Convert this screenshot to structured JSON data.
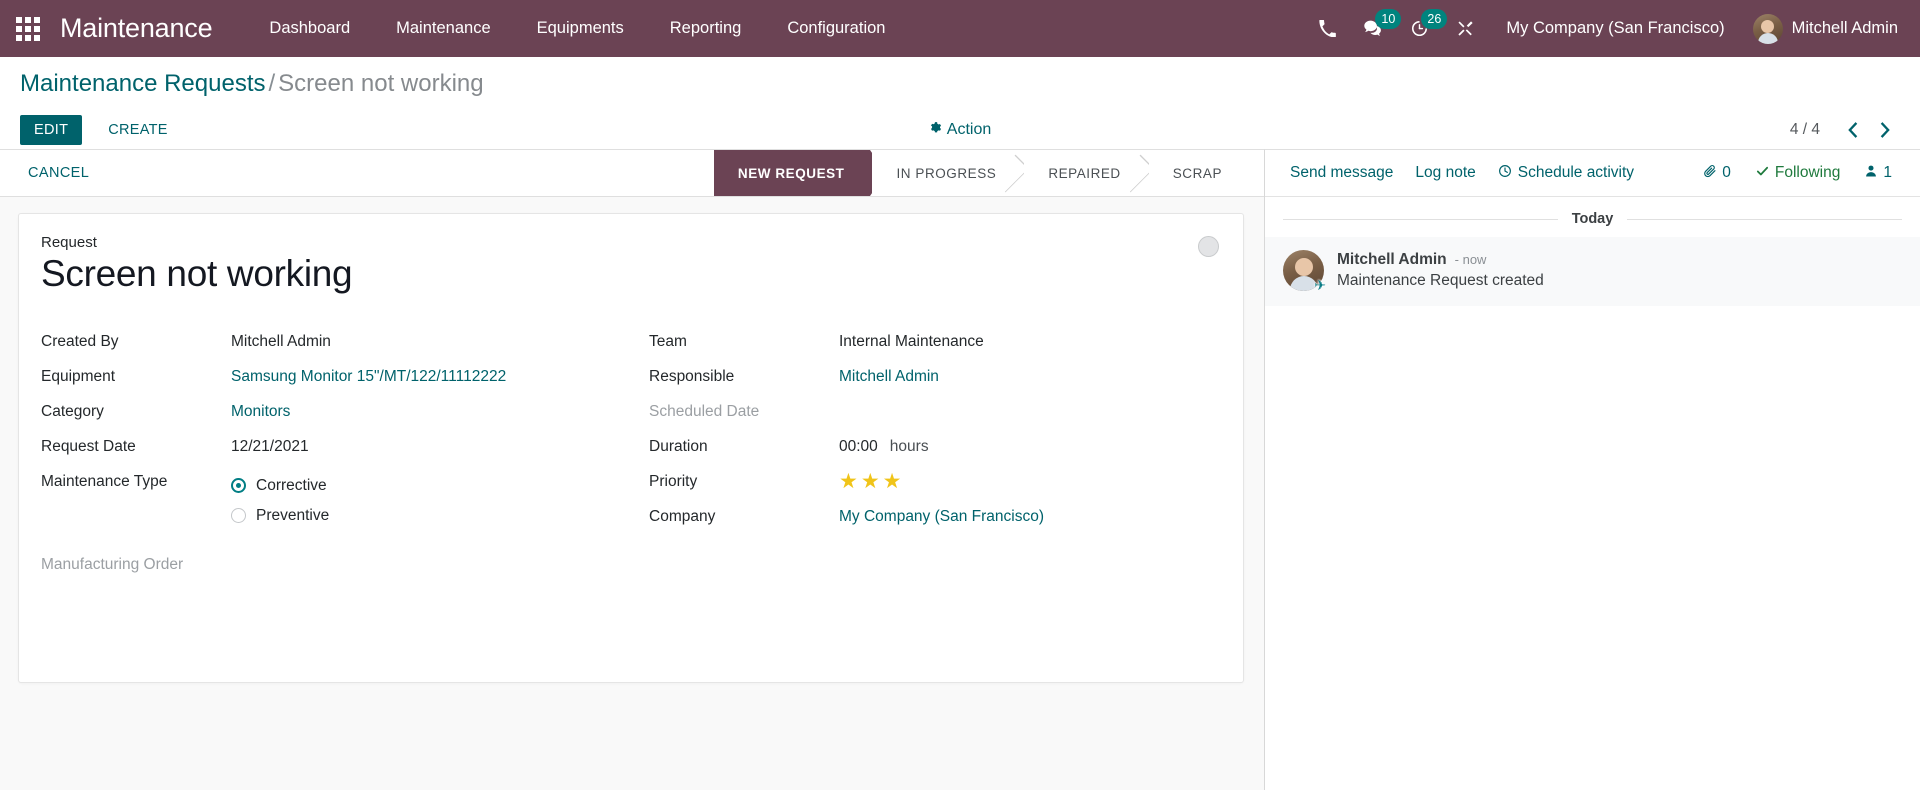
{
  "navbar": {
    "apps_icon": "apps-grid-icon",
    "brand": "Maintenance",
    "menu": [
      {
        "label": "Dashboard"
      },
      {
        "label": "Maintenance"
      },
      {
        "label": "Equipments"
      },
      {
        "label": "Reporting"
      },
      {
        "label": "Configuration"
      }
    ],
    "sys_icons": [
      {
        "name": "phone-icon",
        "badge": ""
      },
      {
        "name": "messages-icon",
        "badge": "10"
      },
      {
        "name": "activities-clock-icon",
        "badge": "26"
      },
      {
        "name": "debug-tools-icon",
        "badge": ""
      }
    ],
    "company": "My Company (San Francisco)",
    "user": "Mitchell Admin"
  },
  "control_panel": {
    "breadcrumb_root": "Maintenance Requests",
    "breadcrumb_sep": "/",
    "breadcrumb_current": "Screen not working",
    "edit_label": "EDIT",
    "create_label": "CREATE",
    "action_label": "Action",
    "pager_value": "4 / 4",
    "prev_icon": "‹",
    "next_icon": "›"
  },
  "statusbar": {
    "cancel_label": "CANCEL",
    "stages": [
      {
        "label": "NEW REQUEST",
        "active": true
      },
      {
        "label": "IN PROGRESS",
        "active": false
      },
      {
        "label": "REPAIRED",
        "active": false
      },
      {
        "label": "SCRAP",
        "active": false
      }
    ]
  },
  "form": {
    "title_label": "Request",
    "title": "Screen not working",
    "kanban_state": "grey",
    "left": [
      {
        "label": "Created By",
        "value": "Mitchell Admin",
        "link": false
      },
      {
        "label": "Equipment",
        "value": "Samsung Monitor 15\"/MT/122/11112222",
        "link": true
      },
      {
        "label": "Category",
        "value": "Monitors",
        "link": true
      },
      {
        "label": "Request Date",
        "value": "12/21/2021",
        "link": false
      }
    ],
    "maintenance_type": {
      "label": "Maintenance Type",
      "options": [
        {
          "label": "Corrective",
          "selected": true
        },
        {
          "label": "Preventive",
          "selected": false
        }
      ]
    },
    "manufacturing_order": {
      "label": "Manufacturing Order",
      "value": ""
    },
    "right": [
      {
        "label": "Team",
        "value": "Internal Maintenance",
        "link": false
      },
      {
        "label": "Responsible",
        "value": "Mitchell Admin",
        "link": true
      },
      {
        "label": "Scheduled Date",
        "value": "",
        "link": false,
        "muted": true
      }
    ],
    "duration": {
      "label": "Duration",
      "value": "00:00",
      "unit": "hours"
    },
    "priority": {
      "label": "Priority",
      "stars": 3,
      "star_glyph": "★",
      "color": "#f0c419"
    },
    "company": {
      "label": "Company",
      "value": "My Company (San Francisco)",
      "link": true
    }
  },
  "chatter": {
    "send_message": "Send message",
    "log_note": "Log note",
    "schedule_activity": "Schedule activity",
    "attachment_count": "0",
    "following_label": "Following",
    "follower_count": "1",
    "date_separator": "Today",
    "messages": [
      {
        "author": "Mitchell Admin",
        "time": "- now",
        "body": "Maintenance Request created"
      }
    ]
  },
  "colors": {
    "brand_purple": "#6b4354",
    "accent_teal": "#00626b",
    "badge_teal": "#00847e",
    "star_gold": "#f0c419",
    "following_green": "#1f7a3d"
  }
}
